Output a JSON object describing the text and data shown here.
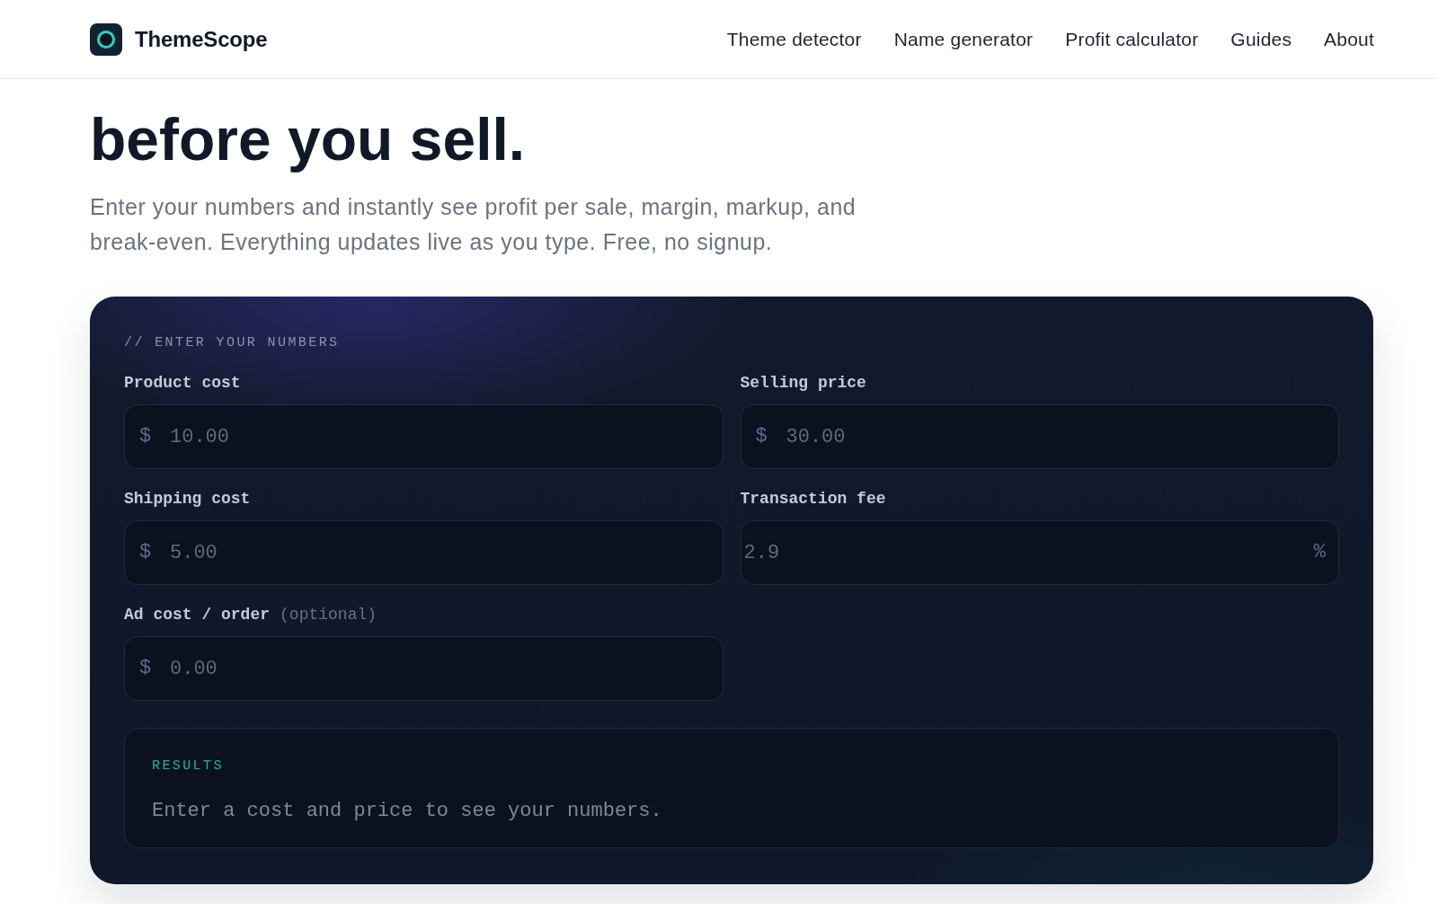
{
  "header": {
    "brand": "ThemeScope",
    "nav": [
      "Theme detector",
      "Name generator",
      "Profit calculator",
      "Guides",
      "About"
    ]
  },
  "hero": {
    "title": "before you sell.",
    "subtitle": "Enter your numbers and instantly see profit per sale, margin, markup, and break-even. Everything updates live as you type. Free, no signup."
  },
  "calculator": {
    "heading": "// ENTER YOUR NUMBERS",
    "fields": [
      {
        "label": "Product cost",
        "prefix": "$",
        "placeholder": "10.00"
      },
      {
        "label": "Selling price",
        "prefix": "$",
        "placeholder": "30.00"
      },
      {
        "label": "Shipping cost",
        "prefix": "$",
        "placeholder": "5.00"
      },
      {
        "label": "Transaction fee",
        "placeholder": "2.9",
        "suffix": "%"
      },
      {
        "label": "Ad cost / order",
        "note": "(optional)",
        "prefix": "$",
        "placeholder": "0.00"
      }
    ],
    "results": {
      "title": "RESULTS",
      "message": "Enter a cost and price to see your numbers."
    }
  }
}
